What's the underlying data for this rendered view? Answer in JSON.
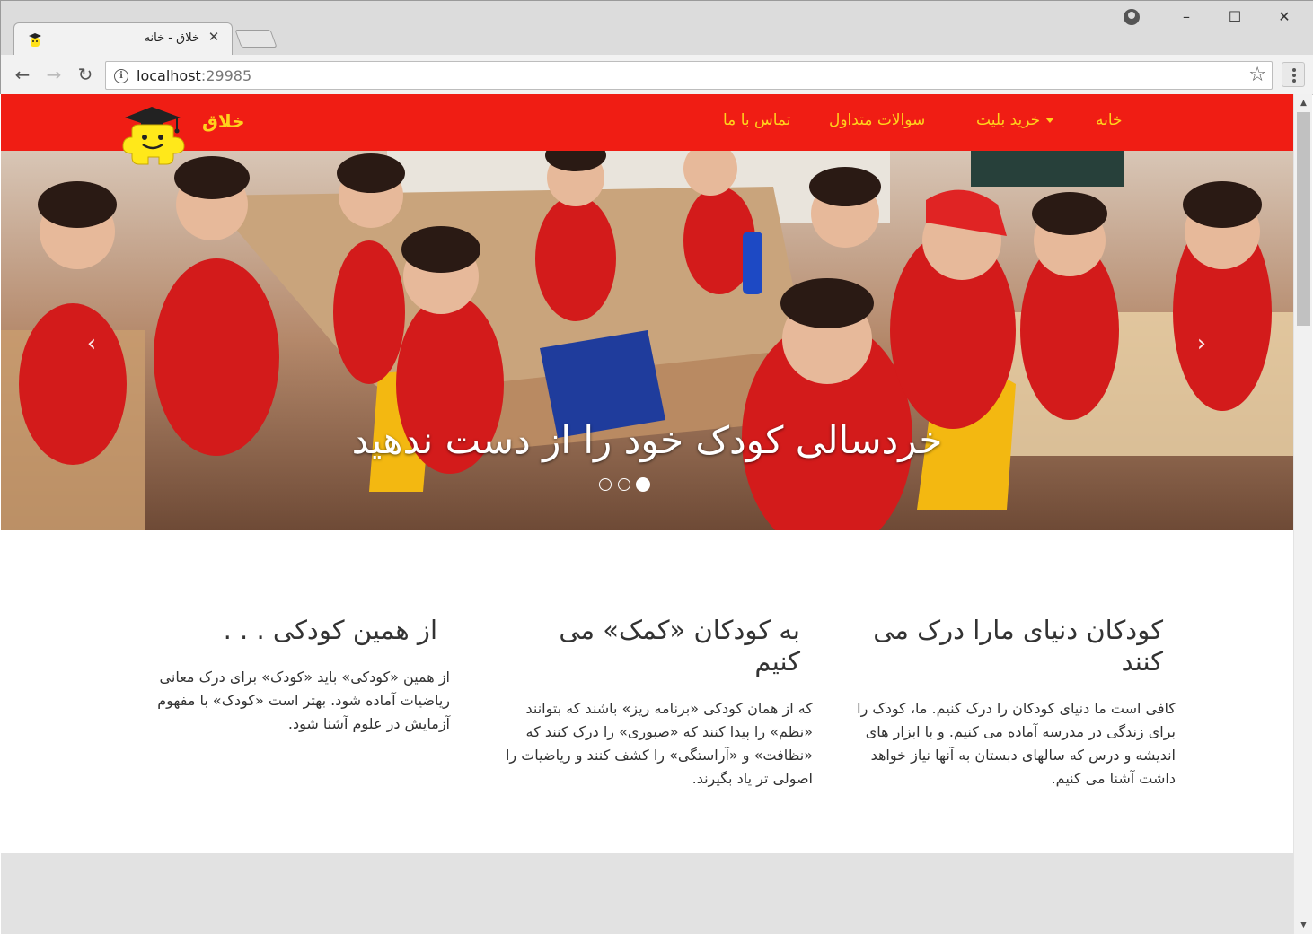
{
  "browser": {
    "tab_title": "خلاق - خانه",
    "url_host": "localhost",
    "url_port": ":29985"
  },
  "site": {
    "brand": "خلاق",
    "nav": [
      {
        "label": "خانه"
      },
      {
        "label": "خرید بلیت",
        "dropdown": true
      },
      {
        "label": "سوالات متداول"
      },
      {
        "label": "تماس با ما"
      }
    ],
    "colors": {
      "navbar": "#f01d14",
      "nav_text": "#ffd21c"
    }
  },
  "hero": {
    "caption": "خردسالی کودک خود را از دست ندهید",
    "slides": 3,
    "active_slide": 1,
    "prev_icon": "chevron-left-icon",
    "next_icon": "chevron-right-icon"
  },
  "features": [
    {
      "title": "کودکان دنیای مارا درک می کنند",
      "body": "کافی است ما دنیای کودکان را درک کنیم. ما، کودک را برای زندگی در مدرسه آماده می کنیم. و با ابزار های اندیشه و درس که سالهای دبستان به آنها نیاز خواهد داشت آشنا می کنیم."
    },
    {
      "title": "به کودکان «کمک» می کنیم",
      "body": "که از همان کودکی «برنامه ریز» باشند که بتوانند «نظم» را پیدا کنند که «صبوری» را درک کنند که «نظافت» و «آراستگی» را کشف کنند و ریاضیات را اصولی تر یاد بگیرند."
    },
    {
      "title": "از همین کودکی . . .",
      "body": "از همین «کودکی» باید «کودک» برای درک معانی ریاضیات آماده شود. بهتر است «کودک» با مفهوم آزمایش در علوم آشنا شود."
    }
  ]
}
